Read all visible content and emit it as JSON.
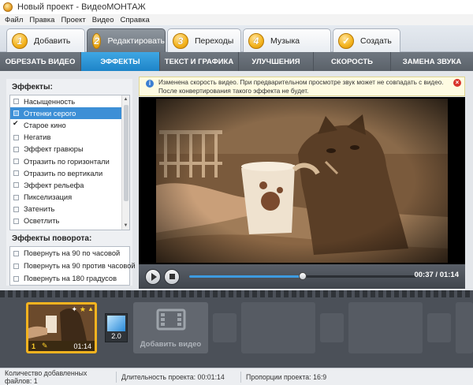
{
  "window": {
    "title": "Новый проект - ВидеоМОНТАЖ"
  },
  "menu": {
    "items": [
      "Файл",
      "Правка",
      "Проект",
      "Видео",
      "Справка"
    ]
  },
  "steps": [
    {
      "number": "1",
      "label": "Добавить"
    },
    {
      "number": "2",
      "label": "Редактировать"
    },
    {
      "number": "3",
      "label": "Переходы"
    },
    {
      "number": "4",
      "label": "Музыка"
    },
    {
      "number": "",
      "label": "Создать"
    }
  ],
  "active_step": "Редактировать",
  "subtabs": [
    "ОБРЕЗАТЬ ВИДЕО",
    "ЭФФЕКТЫ",
    "ТЕКСТ И ГРАФИКА",
    "УЛУЧШЕНИЯ",
    "СКОРОСТЬ",
    "ЗАМЕНА ЗВУКА"
  ],
  "active_subtab": "ЭФФЕКТЫ",
  "effects": {
    "heading": "Эффекты:",
    "items": [
      {
        "label": "Насыщенность",
        "checked": false,
        "selected": false
      },
      {
        "label": "Оттенки серого",
        "checked": false,
        "selected": true
      },
      {
        "label": "Старое кино",
        "checked": true,
        "selected": false
      },
      {
        "label": "Негатив",
        "checked": false,
        "selected": false
      },
      {
        "label": "Эффект гравюры",
        "checked": false,
        "selected": false
      },
      {
        "label": "Отразить по горизонтали",
        "checked": false,
        "selected": false
      },
      {
        "label": "Отразить по вертикали",
        "checked": false,
        "selected": false
      },
      {
        "label": "Эффект рельефа",
        "checked": false,
        "selected": false
      },
      {
        "label": "Пикселизация",
        "checked": false,
        "selected": false
      },
      {
        "label": "Затенить",
        "checked": false,
        "selected": false
      },
      {
        "label": "Осветлить",
        "checked": false,
        "selected": false
      }
    ]
  },
  "rotation": {
    "heading": "Эффекты поворота:",
    "items": [
      {
        "label": "Повернуть на 90 по часовой",
        "checked": false
      },
      {
        "label": "Повернуть на 90 против часовой",
        "checked": false
      },
      {
        "label": "Повернуть на 180 градусов",
        "checked": false
      }
    ]
  },
  "notice": {
    "text": "Изменена скорость видео. При предварительном просмотре звук может не совпадать с видео. После конвертирования такого эффекта не будет."
  },
  "player": {
    "time": "00:37 / 01:14",
    "progress_fraction": 0.5
  },
  "storyboard": {
    "clip": {
      "index": "1",
      "duration": "01:14"
    },
    "transition_duration": "2.0",
    "add_video_label": "Добавить видео"
  },
  "status": {
    "files_count": "Количество добавленных файлов: 1",
    "duration": "Длительность проекта: 00:01:14",
    "aspect": "Пропорции проекта: 16:9"
  },
  "colors": {
    "accent": "#1e84c8",
    "step_badge": "#f3b31c",
    "clip_border": "#f4b31f"
  }
}
